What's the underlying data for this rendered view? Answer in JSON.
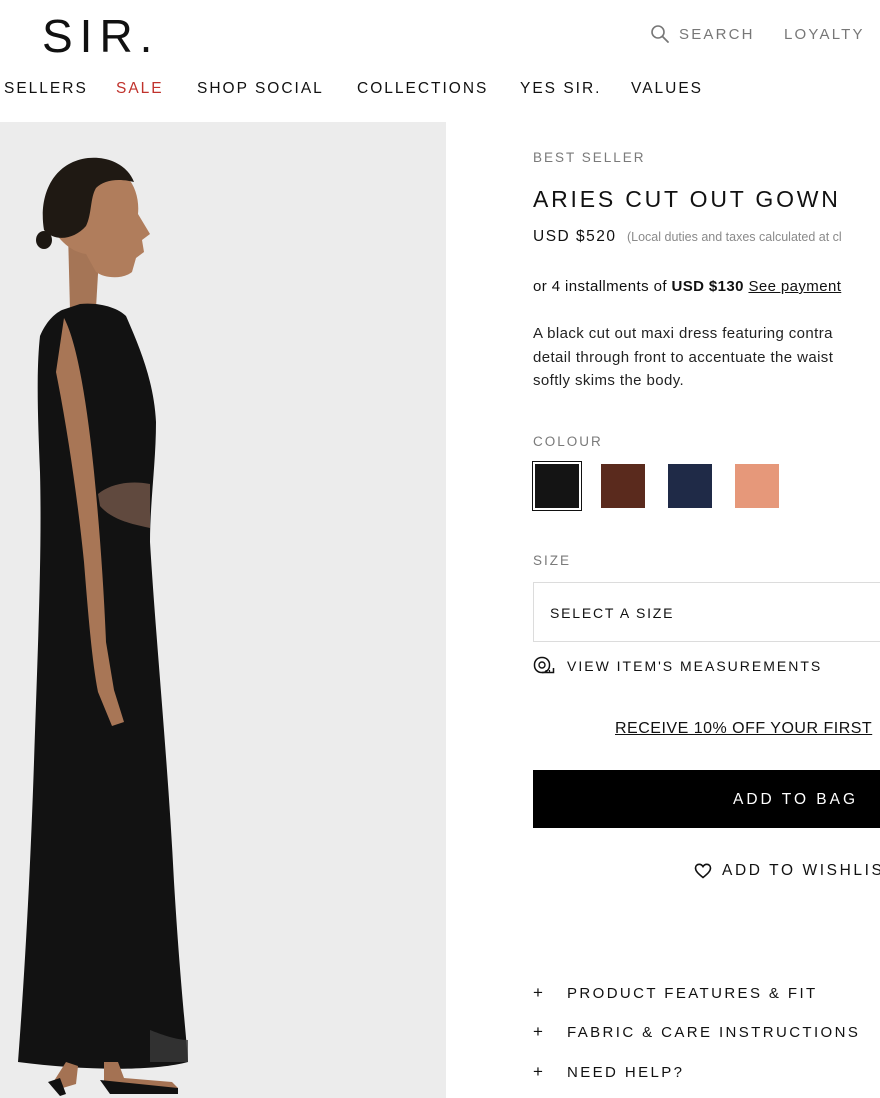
{
  "header": {
    "logo": "SIR.",
    "search_label": "SEARCH",
    "loyalty_label": "LOYALTY"
  },
  "nav": {
    "items": [
      "SELLERS",
      "SALE",
      "SHOP SOCIAL",
      "COLLECTIONS",
      "YES SIR.",
      "VALUES"
    ],
    "sale_color": "#c0322c"
  },
  "product": {
    "badge": "BEST SELLER",
    "title": "ARIES CUT OUT GOWN",
    "price": "USD $520",
    "duties_note": "(Local duties and taxes calculated at cl",
    "installment_prefix": "or 4 installments of ",
    "installment_amount": "USD $130",
    "installment_link": "See payment",
    "description_lines": [
      "A black cut out maxi dress featuring contra",
      "detail through front to accentuate the waist",
      "softly skims the body."
    ]
  },
  "colour": {
    "label": "COLOUR",
    "swatches": [
      {
        "name": "black-swatch",
        "hex": "#141414",
        "selected": true
      },
      {
        "name": "brown-swatch",
        "hex": "#5a2a1d",
        "selected": false
      },
      {
        "name": "navy-swatch",
        "hex": "#1f2a47",
        "selected": false
      },
      {
        "name": "peach-swatch",
        "hex": "#e6987a",
        "selected": false
      }
    ]
  },
  "size": {
    "label": "SIZE",
    "placeholder": "SELECT A SIZE",
    "measurements_link": "VIEW ITEM'S MEASUREMENTS"
  },
  "promo": {
    "text": "RECEIVE 10% OFF YOUR FIRST"
  },
  "actions": {
    "add_to_bag": "ADD TO BAG",
    "add_to_wishlist": "ADD TO WISHLIS"
  },
  "accordions": [
    {
      "icon": "+",
      "label": "PRODUCT FEATURES & FIT"
    },
    {
      "icon": "+",
      "label": "FABRIC & CARE INSTRUCTIONS"
    },
    {
      "icon": "+",
      "label": "NEED HELP?"
    }
  ]
}
